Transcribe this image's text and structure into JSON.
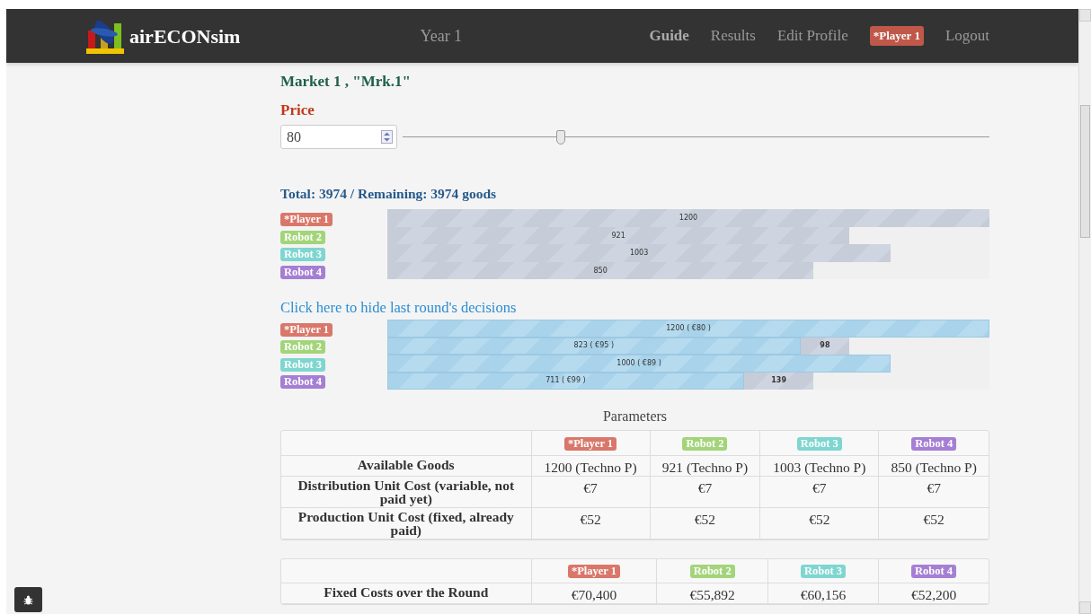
{
  "navbar": {
    "brand": "airECONsim",
    "year": "Year 1",
    "links": [
      {
        "label": "Guide",
        "selected": true
      },
      {
        "label": "Results",
        "selected": false
      },
      {
        "label": "Edit Profile",
        "selected": false
      }
    ],
    "player_badge": "*Player 1",
    "logout": "Logout"
  },
  "market": {
    "title": "Market 1 , \"Mrk.1\"",
    "price_label": "Price",
    "price_value": "80",
    "price_slider": {
      "level": 0.27
    }
  },
  "totals": "Total: 3974 / Remaining: 3974 goods",
  "goods_bars": [
    {
      "label": "*Player 1",
      "color": "#d9776a",
      "text": "1200",
      "level": 1.0
    },
    {
      "label": "Robot 2",
      "color": "#a3d47a",
      "text": "921",
      "level": 0.7675
    },
    {
      "label": "Robot 3",
      "color": "#7fd6d0",
      "text": "1003",
      "level": 0.836
    },
    {
      "label": "Robot 4",
      "color": "#a57fd3",
      "text": "850",
      "level": 0.708
    }
  ],
  "last_round": {
    "toggle": "Click here to hide last round's decisions",
    "rows": [
      {
        "label": "*Player 1",
        "color": "#d9776a",
        "segments": [
          {
            "kind": "sold",
            "text": "1200 ( €80 )",
            "level": 1.0
          }
        ]
      },
      {
        "label": "Robot 2",
        "color": "#a3d47a",
        "segments": [
          {
            "kind": "sold",
            "text": "823 ( €95 )",
            "level": 0.686
          },
          {
            "kind": "unsold",
            "text": "98"
          }
        ]
      },
      {
        "label": "Robot 3",
        "color": "#7fd6d0",
        "segments": [
          {
            "kind": "sold",
            "text": "1000 ( €89 )",
            "level": 0.836
          }
        ]
      },
      {
        "label": "Robot 4",
        "color": "#a57fd3",
        "segments": [
          {
            "kind": "sold",
            "text": "711 ( €99 )",
            "level": 0.5925
          },
          {
            "kind": "unsold",
            "text": "139"
          }
        ]
      }
    ]
  },
  "parameters": {
    "caption": "Parameters",
    "columns": [
      {
        "label": "*Player 1",
        "color": "#d9776a"
      },
      {
        "label": "Robot 2",
        "color": "#a3d47a"
      },
      {
        "label": "Robot 3",
        "color": "#7fd6d0"
      },
      {
        "label": "Robot 4",
        "color": "#a57fd3"
      }
    ],
    "rows": [
      {
        "label": "Available Goods",
        "cells": [
          "1200 (Techno P)",
          "921 (Techno P)",
          "1003 (Techno P)",
          "850 (Techno P)"
        ]
      },
      {
        "label": "Distribution Unit Cost (variable, not paid yet)",
        "cells": [
          "€7",
          "€7",
          "€7",
          "€7"
        ]
      },
      {
        "label": "Production Unit Cost (fixed, already paid)",
        "cells": [
          "€52",
          "€52",
          "€52",
          "€52"
        ]
      }
    ]
  },
  "costs": {
    "columns": [
      {
        "label": "*Player 1",
        "color": "#d9776a"
      },
      {
        "label": "Robot 2",
        "color": "#a3d47a"
      },
      {
        "label": "Robot 3",
        "color": "#7fd6d0"
      },
      {
        "label": "Robot 4",
        "color": "#a57fd3"
      }
    ],
    "rows": [
      {
        "label": "Fixed Costs over the Round",
        "cells": [
          "€70,400",
          "€55,892",
          "€60,156",
          "€52,200"
        ]
      }
    ]
  }
}
